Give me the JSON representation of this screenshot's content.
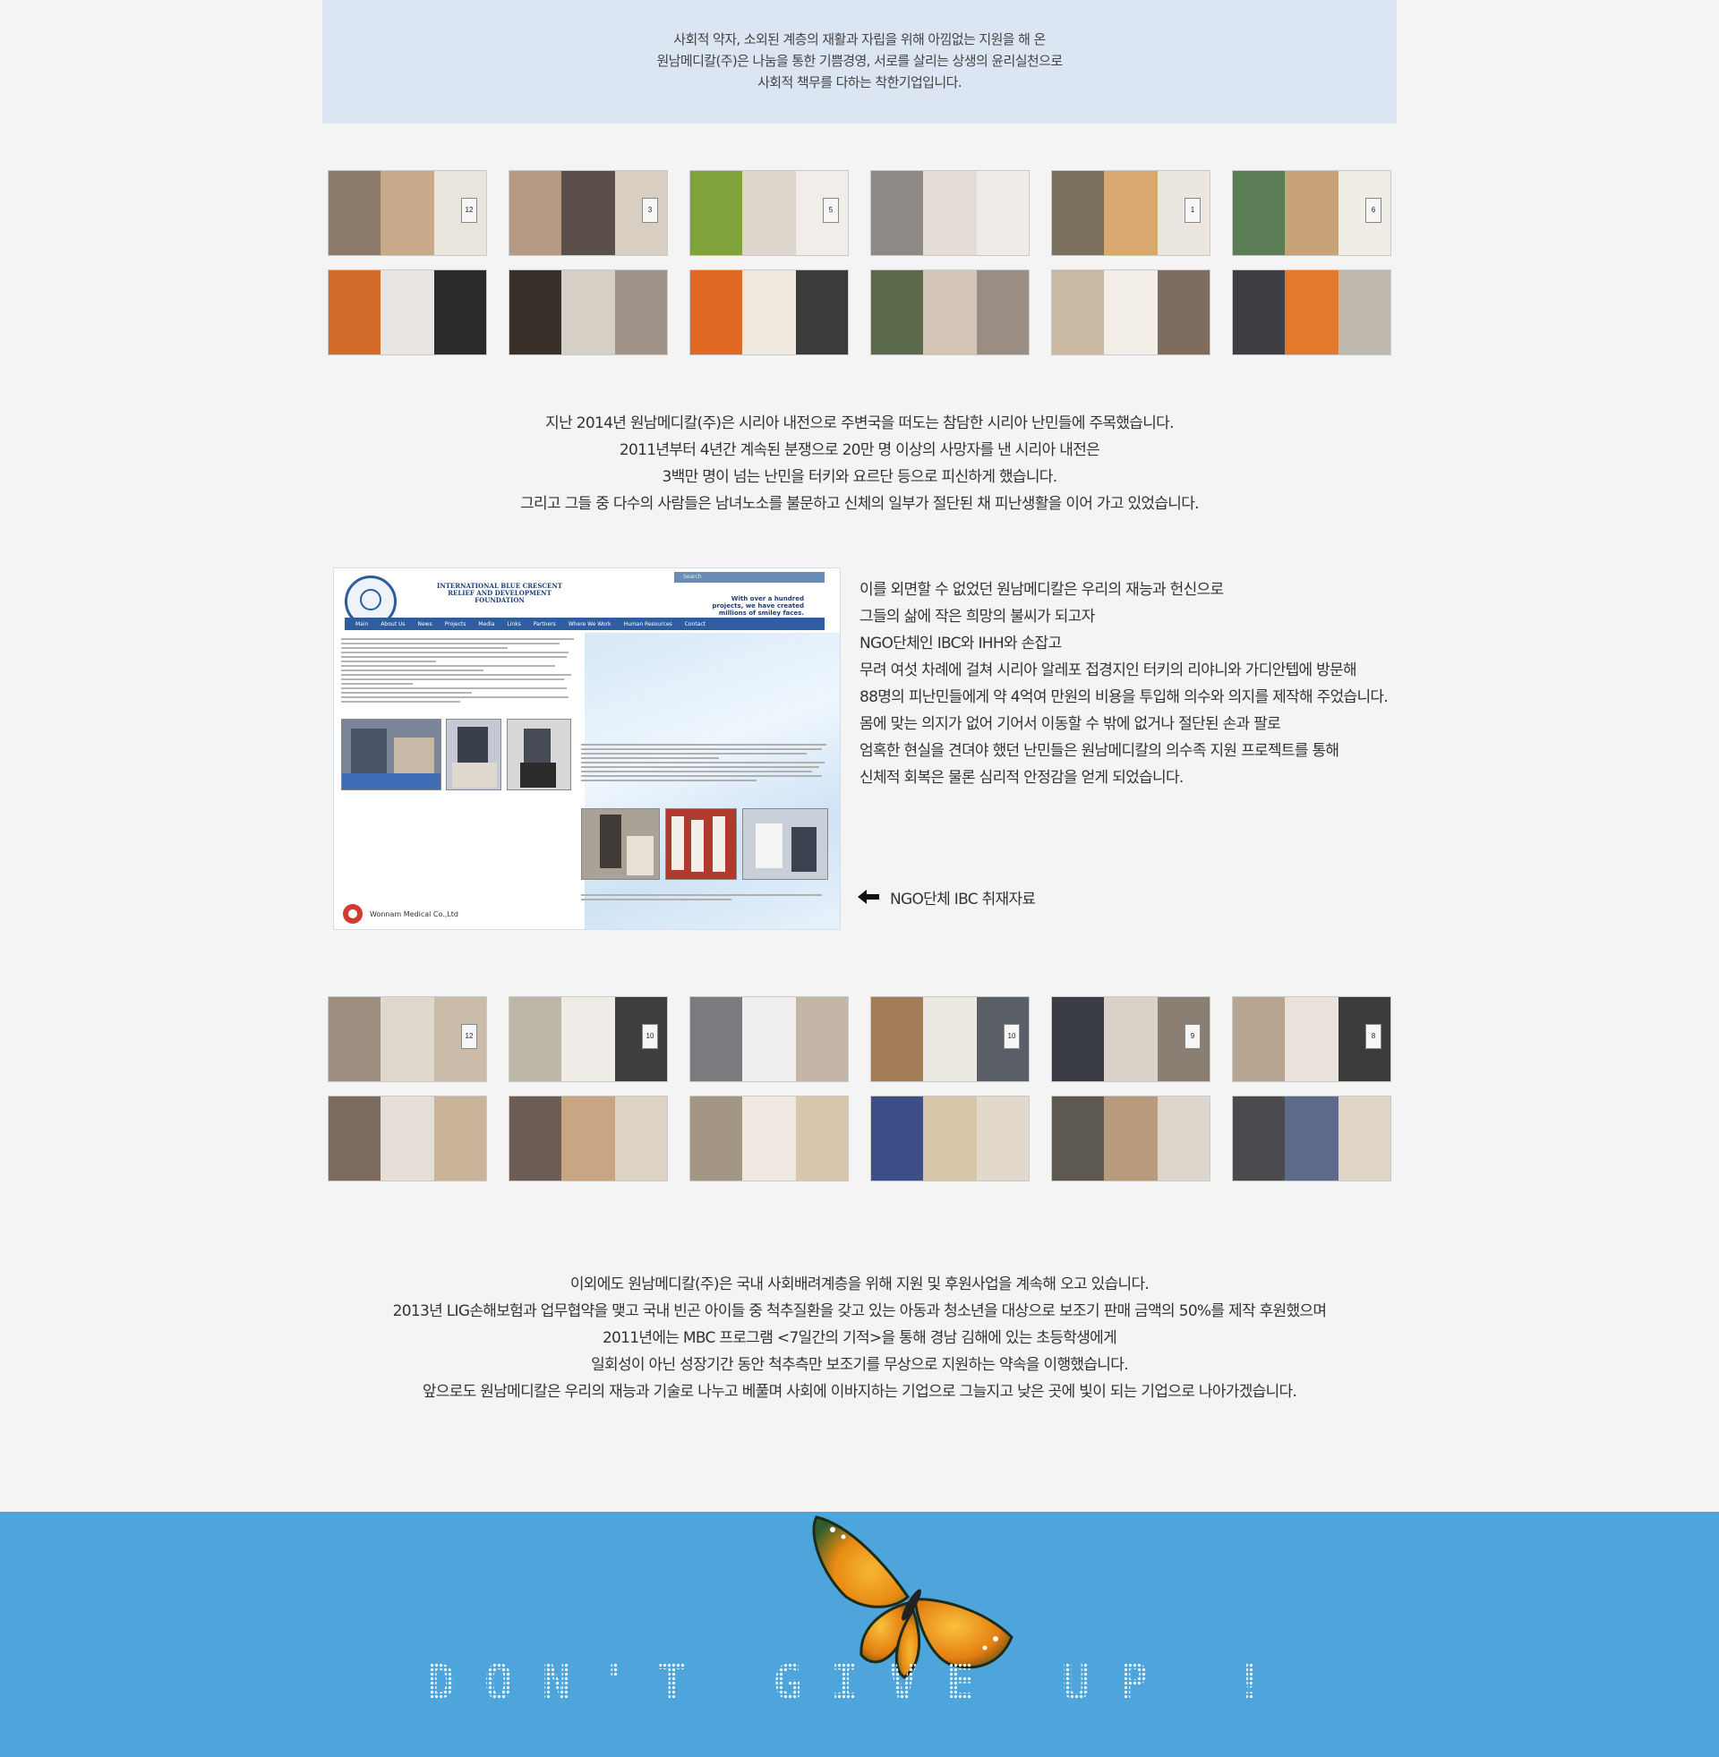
{
  "intro": {
    "lines": [
      "사회적 약자, 소외된 계층의 재활과 자립을 위해 아낌없는 지원을 해 온",
      "원남메디칼(주)은 나눔을 통한 기쁨경영, 서로를 살리는 상생의 윤리실천으로",
      "사회적 책무를 다하는 착한기업입니다."
    ]
  },
  "gallery_top_numbers": [
    "12",
    "3",
    "5",
    "",
    "1",
    "6"
  ],
  "syria": {
    "lines": [
      "지난 2014년 원남메디칼(주)은 시리아 내전으로 주변국을 떠도는 참담한 시리아 난민들에 주목했습니다.",
      "2011년부터 4년간 계속된 분쟁으로 20만 명 이상의 사망자를 낸 시리아 내전은",
      "3백만 명이 넘는 난민을 터키와 요르단 등으로 피신하게 했습니다.",
      "그리고 그들 중 다수의 사람들은 남녀노소를 불문하고 신체의 일부가 절단된 채  피난생활을 이어 가고 있었습니다."
    ]
  },
  "ngo_shot": {
    "title_lines": [
      "INTERNATIONAL BLUE CRESCENT",
      "RELIEF AND DEVELOPMENT",
      "FOUNDATION"
    ],
    "search": "Search",
    "tagline": [
      "With over a hundred",
      "projects, we have created",
      "millions of smiley faces."
    ],
    "nav": [
      "Main",
      "About Us",
      "News",
      "Projects",
      "Media",
      "Links",
      "Partners",
      "Where We Work",
      "Human Resources",
      "Contact"
    ],
    "footer_brand": "Wonnam Medical Co.,Ltd"
  },
  "project": {
    "lines": [
      " 이를 외면할 수 없었던 원남메디칼은 우리의 재능과 헌신으로",
      "그들의 삶에 작은 희망의 불씨가 되고자",
      "NGO단체인 IBC와 IHH와 손잡고",
      "무려 여섯 차례에 걸쳐 시리아 알레포 접경지인 터키의 리야니와 가디안텝에 방문해",
      "88명의 피난민들에게 약 4억여 만원의 비용을 투입해 의수와 의지를 제작해 주었습니다.",
      "몸에 맞는 의지가 없어 기어서 이동할 수 밖에 없거나 절단된 손과 팔로",
      "엄혹한 현실을 견뎌야 했던 난민들은 원남메디칼의 의수족 지원 프로젝트를 통해",
      "신체적 회복은 물론 심리적 안정감을 얻게 되었습니다."
    ],
    "caption": "NGO단체 IBC 취재자료"
  },
  "gallery_bottom_numbers": [
    "12",
    "10",
    "",
    "10",
    "9",
    "8"
  ],
  "domestic": {
    "lines": [
      "이외에도 원남메디칼(주)은 국내 사회배려계층을 위해 지원 및 후원사업을 계속해 오고 있습니다.",
      "2013년 LIG손해보험과 업무협약을 맺고 국내 빈곤 아이들 중 척추질환을 갖고 있는 아동과 청소년을 대상으로 보조기 판매 금액의 50%를 제작 후원했으며",
      "2011년에는 MBC 프로그램 <7일간의 기적>을 통해 경남 김해에 있는 초등학생에게",
      "일회성이 아닌 성장기간 동안 척추측만 보조기를 무상으로 지원하는 약속을  이행했습니다.",
      "앞으로도 원남메디칼은 우리의 재능과 기술로 나누고 베풀며  사회에 이바지하는 기업으로 그늘지고 낮은 곳에 빛이 되는 기업으로 나아가겠습니다."
    ]
  },
  "footer": {
    "slogan": "DON'T GIVE UP !",
    "background": "#4ea5dc",
    "icon": "butterfly-icon"
  }
}
